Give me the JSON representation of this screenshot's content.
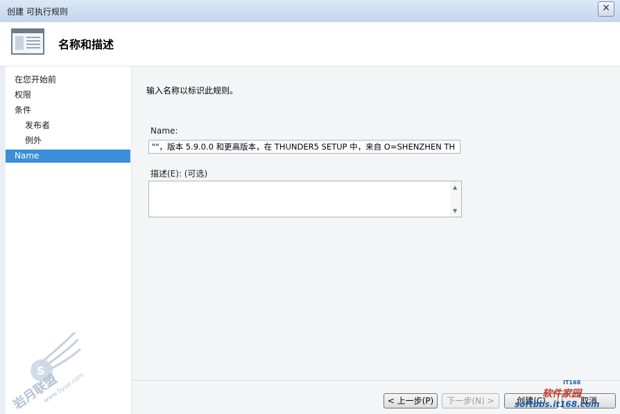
{
  "window": {
    "title": "创建 可执行规则",
    "close_glyph": "✕"
  },
  "header": {
    "title": "名称和描述",
    "icon": "window-list-icon"
  },
  "nav": {
    "items": [
      {
        "label": "在您开始前",
        "level": 0,
        "selected": false
      },
      {
        "label": "权限",
        "level": 0,
        "selected": false
      },
      {
        "label": "条件",
        "level": 0,
        "selected": false
      },
      {
        "label": "发布者",
        "level": 1,
        "selected": false
      },
      {
        "label": "例外",
        "level": 1,
        "selected": false
      },
      {
        "label": "Name",
        "level": 0,
        "selected": true
      }
    ]
  },
  "main": {
    "instruction": "输入名称以标识此规则。",
    "name_label": "Name:",
    "name_value": "\"\"，版本 5.9.0.0 和更高版本，在 THUNDER5 SETUP 中，来自 O=SHENZHEN TH",
    "desc_label": "描述(E): (可选)",
    "desc_value": ""
  },
  "buttons": {
    "prev": "< 上一步(P)",
    "next": "下一步(N) >",
    "create": "创建(C)",
    "cancel": "取消"
  },
  "watermarks": {
    "left_text": "岩月联盟",
    "left_url": "www.5yue.com",
    "right_brand": "软件家园",
    "right_badge": "IT168",
    "right_url": "softbbs.it168.com"
  },
  "colors": {
    "titlebar": "#c3d6ee",
    "selection": "#3c8ed8",
    "main_bg": "#f4f5f7"
  }
}
